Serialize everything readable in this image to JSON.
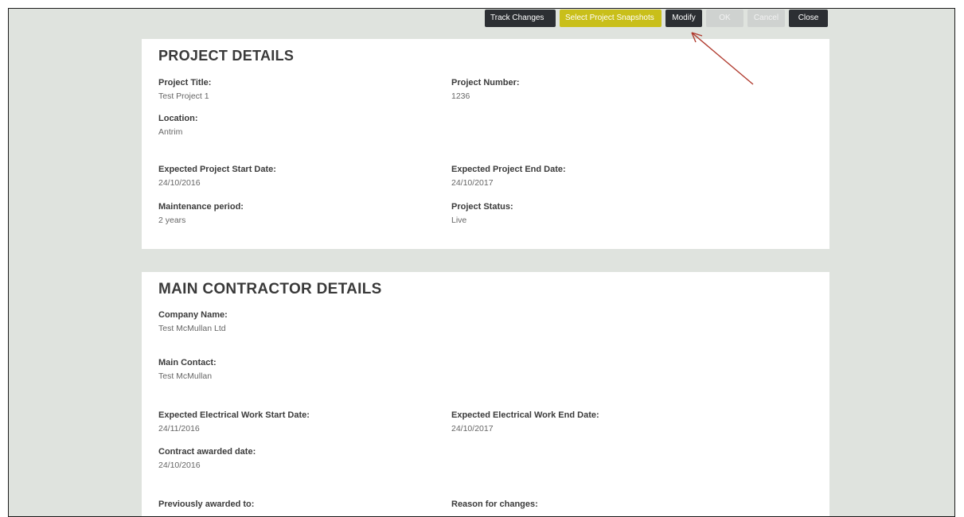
{
  "toolbar": {
    "track_changes": "Track Changes",
    "select_snapshots": "Select Project Snapshots",
    "modify": "Modify",
    "ok": "OK",
    "cancel": "Cancel",
    "close": "Close"
  },
  "project": {
    "heading": "PROJECT DETAILS",
    "fields": [
      {
        "label": "Project Title:",
        "value": "Test Project 1"
      },
      {
        "label": "Project Number:",
        "value": "1236"
      },
      {
        "label": "Location:",
        "value": "Antrim"
      },
      {
        "label": "Expected Project Start Date:",
        "value": "24/10/2016"
      },
      {
        "label": "Expected Project End Date:",
        "value": "24/10/2017"
      },
      {
        "label": "Maintenance period:",
        "value": "2 years"
      },
      {
        "label": "Project Status:",
        "value": "Live"
      }
    ]
  },
  "contractor": {
    "heading": "MAIN CONTRACTOR DETAILS",
    "fields": [
      {
        "label": "Company Name:",
        "value": "Test McMullan Ltd"
      },
      {
        "label": "Main Contact:",
        "value": "Test McMullan"
      },
      {
        "label": "Expected Electrical Work Start Date:",
        "value": "24/11/2016"
      },
      {
        "label": "Expected Electrical Work End Date:",
        "value": "24/10/2017"
      },
      {
        "label": "Contract awarded date:",
        "value": "24/10/2016"
      },
      {
        "label": "Previously awarded to:",
        "value": ""
      },
      {
        "label": "Reason for changes:",
        "value": ""
      }
    ]
  },
  "colors": {
    "background": "#dfe3de",
    "dark_button": "#2c2f33",
    "snapshot_button": "#c9bf1a",
    "disabled_button": "#cfd2d0",
    "annotation_arrow": "#b03a2e"
  },
  "icons": {
    "annotation": "red-arrow-icon"
  }
}
